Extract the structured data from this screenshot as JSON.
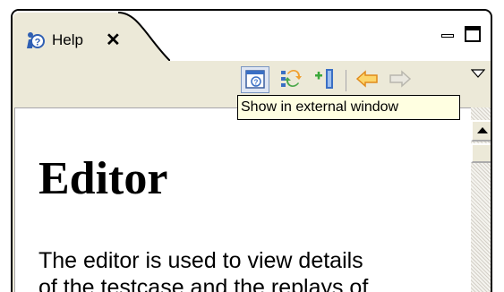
{
  "tab": {
    "label": "Help",
    "close_glyph": "✕",
    "icon": "help-view-icon"
  },
  "window_controls": {
    "minimize_icon": "minimize-icon",
    "maximize_icon": "maximize-icon"
  },
  "toolbar": {
    "buttons": [
      {
        "icon": "show-external-window-icon",
        "active": true
      },
      {
        "icon": "sync-navigation-icon",
        "active": false
      },
      {
        "icon": "bookmark-add-icon",
        "active": false
      },
      {
        "icon": "back-arrow-icon",
        "active": false
      },
      {
        "icon": "forward-arrow-icon",
        "active": false,
        "disabled": true
      }
    ],
    "menu_icon": "view-menu-icon"
  },
  "tooltip": {
    "text": "Show in external window"
  },
  "content": {
    "heading": "Editor",
    "paragraph_line1": "The editor is used to view details",
    "paragraph_line2": "of the testcase and the replays of"
  },
  "colors": {
    "frame_background": "#ece9d8",
    "tooltip_background": "#ffffe1",
    "content_background": "#ffffff",
    "arrow_orange": "#f0a030"
  }
}
